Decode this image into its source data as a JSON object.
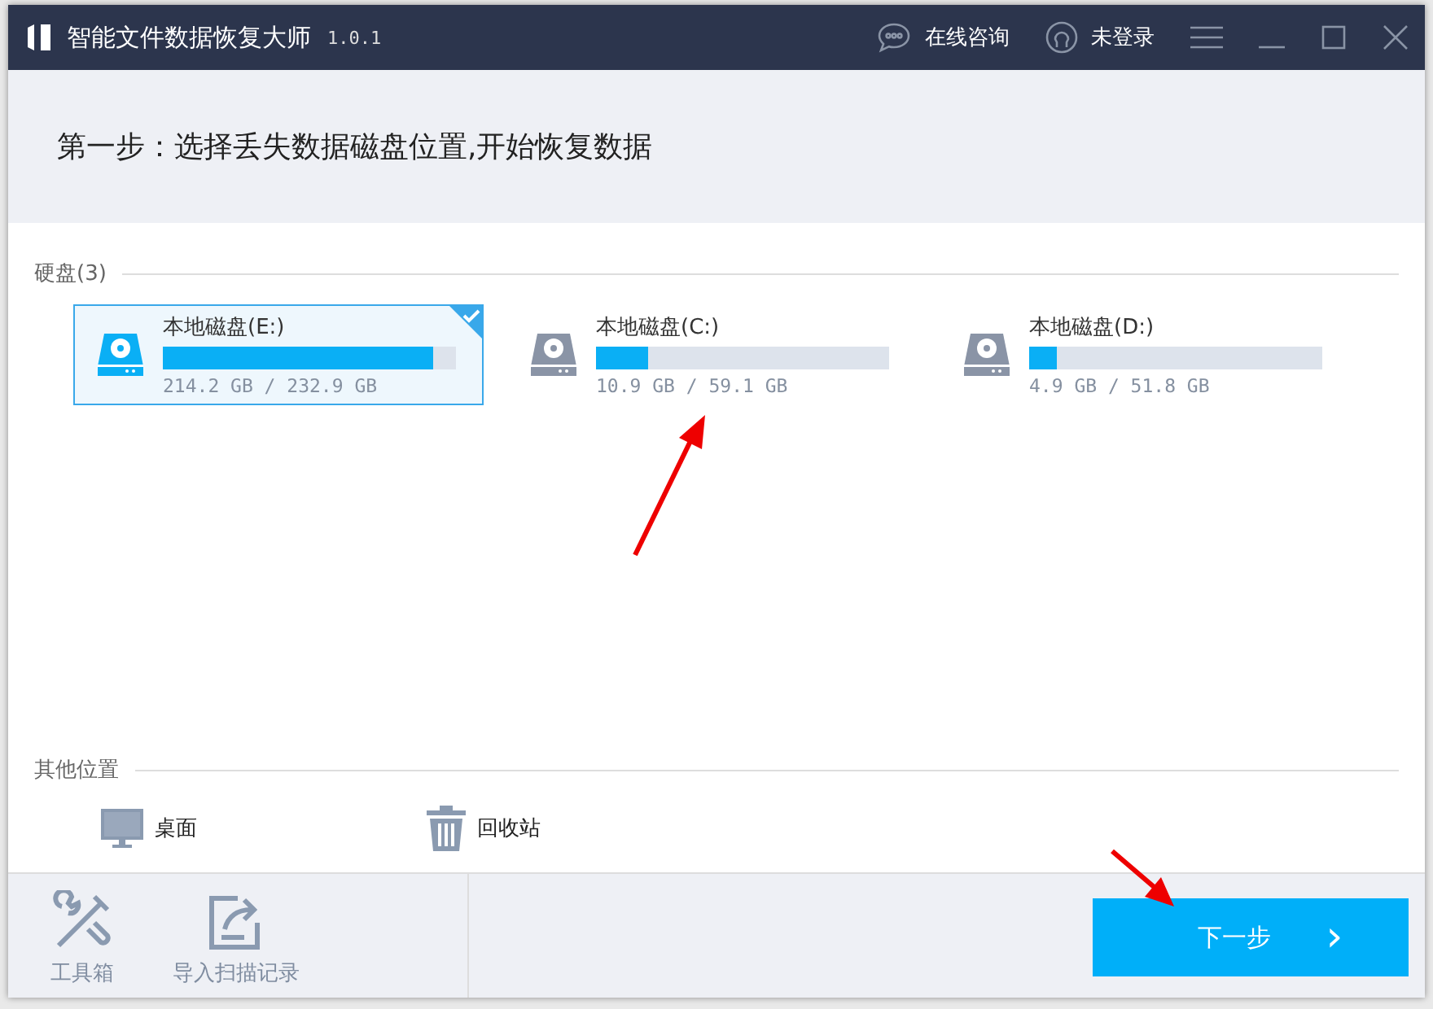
{
  "window": {
    "title": "智能文件数据恢复大师",
    "version": "1.0.1",
    "consult": "在线咨询",
    "login": "未登录"
  },
  "step": "第一步：选择丢失数据磁盘位置,开始恢复数据",
  "disks_section": {
    "label": "硬盘(3)",
    "disks": [
      {
        "name": "本地磁盘(E:)",
        "usage": "214.2 GB / 232.9 GB",
        "level": 0.92,
        "selected": true
      },
      {
        "name": "本地磁盘(C:)",
        "usage": "10.9 GB / 59.1 GB",
        "level": 0.18,
        "selected": false
      },
      {
        "name": "本地磁盘(D:)",
        "usage": "4.9 GB / 51.8 GB",
        "level": 0.095,
        "selected": false
      }
    ]
  },
  "other_section": {
    "label": "其他位置",
    "places": [
      {
        "kind": "desktop",
        "label": "桌面"
      },
      {
        "kind": "recycle",
        "label": "回收站"
      }
    ]
  },
  "footer": {
    "tools": [
      {
        "kind": "toolbox",
        "label": "工具箱"
      },
      {
        "kind": "import",
        "label": "导入扫描记录"
      }
    ],
    "next": "下一步",
    "next_arrow": "›"
  }
}
